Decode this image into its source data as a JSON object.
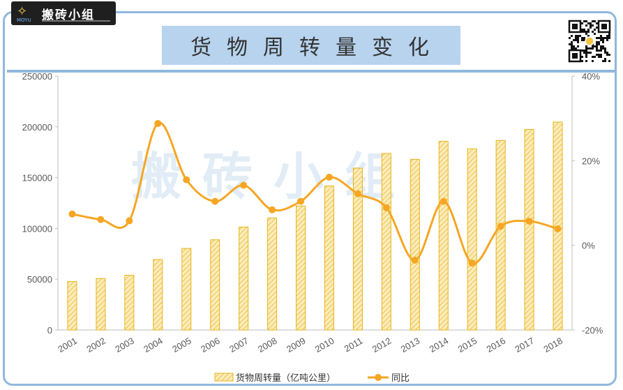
{
  "brand": {
    "name": "搬砖小组",
    "sub": "MOYU",
    "logo_icon": "rocket-logo-icon"
  },
  "title": "货物周转量变化",
  "watermark": "搬砖小组",
  "chart_data": {
    "type": "bar+line",
    "categories": [
      "2001",
      "2002",
      "2003",
      "2004",
      "2005",
      "2006",
      "2007",
      "2008",
      "2009",
      "2010",
      "2011",
      "2012",
      "2013",
      "2014",
      "2015",
      "2016",
      "2017",
      "2018"
    ],
    "series": [
      {
        "name": "货物周转量（亿吨公里）",
        "type": "bar",
        "axis": "left",
        "values": [
          47700,
          50700,
          53900,
          69400,
          80300,
          88800,
          101400,
          110300,
          122100,
          141800,
          159300,
          173800,
          168000,
          185800,
          178400,
          186600,
          197400,
          204700
        ]
      },
      {
        "name": "同比",
        "type": "line",
        "axis": "right",
        "values": [
          7.4,
          6.1,
          5.8,
          28.8,
          15.5,
          10.4,
          14.2,
          8.4,
          10.4,
          16.1,
          12.2,
          8.9,
          -3.5,
          10.4,
          -4.2,
          4.5,
          5.7,
          3.9
        ]
      }
    ],
    "y_left": {
      "ylim": [
        0,
        250000
      ],
      "ticks": [
        "0",
        "50000",
        "100000",
        "150000",
        "200000",
        "250000"
      ]
    },
    "y_right": {
      "ylim": [
        -20,
        40
      ],
      "ticks": [
        "-20%",
        "0%",
        "20%",
        "40%"
      ]
    },
    "colors": {
      "bar_fill": "#fbe5a6",
      "bar_stroke": "#e7b318",
      "line": "#f5a623",
      "frame": "#8fb8de",
      "title_bg": "#b7d3ee"
    },
    "legend_position": "bottom",
    "grid": false
  }
}
